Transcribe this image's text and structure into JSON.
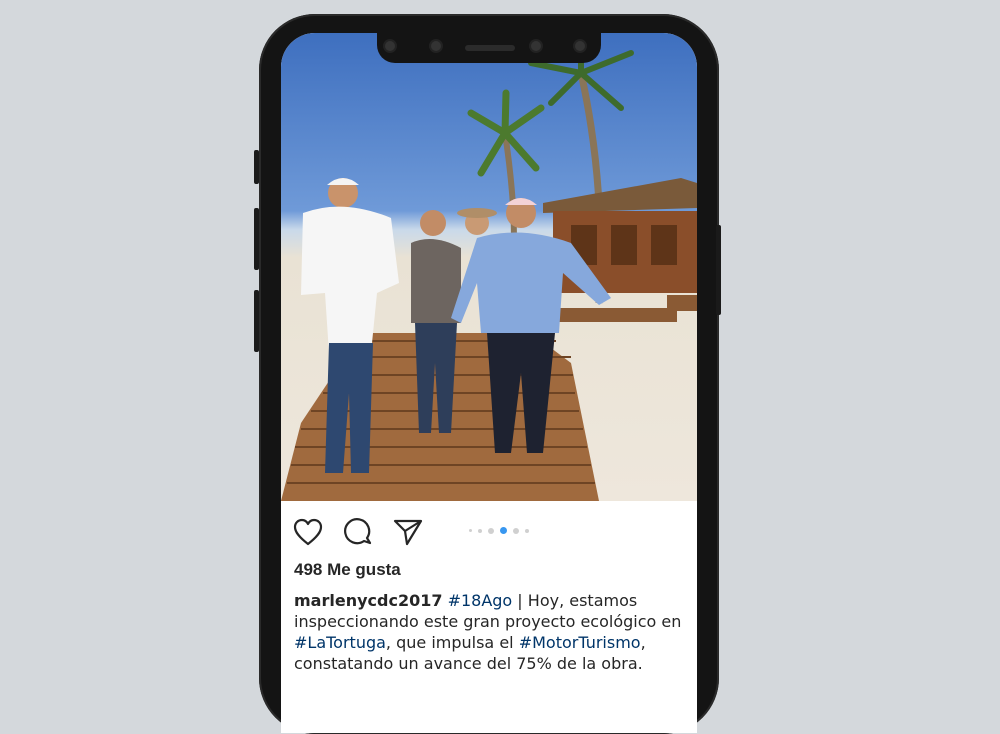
{
  "post": {
    "photo_description_icon": "photo",
    "carousel": {
      "count": 6,
      "active_index": 3
    },
    "likes_text": "498 Me gusta",
    "caption": {
      "username": "marlenycdc2017",
      "parts": [
        {
          "type": "tag",
          "text": "#18Ago"
        },
        {
          "type": "text",
          "text": " | Hoy, estamos inspeccionando este gran proyecto ecológico en "
        },
        {
          "type": "tag",
          "text": "#LaTortuga"
        },
        {
          "type": "text",
          "text": ", que impulsa el "
        },
        {
          "type": "tag",
          "text": "#MotorTurismo"
        },
        {
          "type": "text",
          "text": ", constatando un avance del 75% de la obra."
        }
      ]
    }
  },
  "colors": {
    "hashtag": "#003569",
    "carousel_active": "#3897f0",
    "text": "#262626"
  }
}
